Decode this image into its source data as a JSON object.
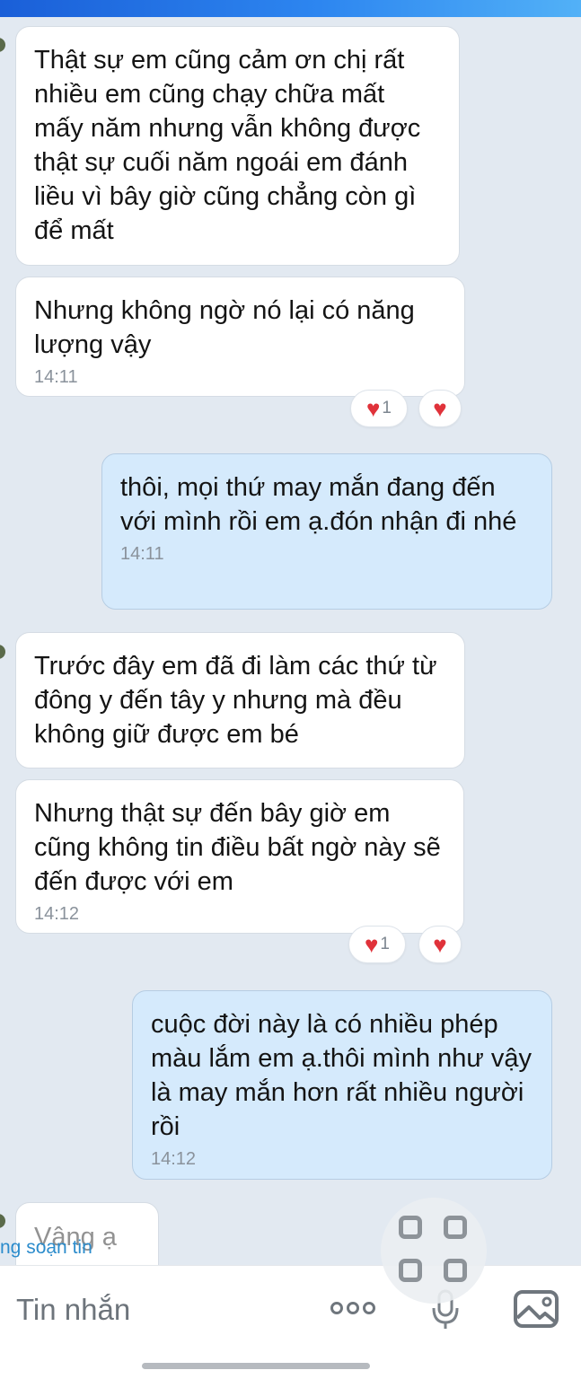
{
  "colors": {
    "background": "#e2e9f1",
    "incoming_bubble": "#ffffff",
    "outgoing_bubble": "#d5eafc",
    "heart": "#e0323a",
    "typing_text": "#2c8ccc"
  },
  "messages": [
    {
      "side": "in",
      "text": "Thật sự em cũng cảm ơn chị rất nhiều em cũng chạy chữa mất mấy năm nhưng vẫn không được thật sự cuối năm ngoái em đánh liều vì bây giờ cũng chẳng còn gì để mất",
      "time": ""
    },
    {
      "side": "in",
      "text": "Nhưng không ngờ nó lại có năng lượng vậy",
      "time": "14:11",
      "reaction_count": "1"
    },
    {
      "side": "out",
      "text": "thôi, mọi thứ may mắn đang đến với mình rồi em ạ.đón nhận đi nhé",
      "time": "14:11"
    },
    {
      "side": "in",
      "text": "Trước đây em đã đi làm các thứ từ đông y đến tây y nhưng mà đều không giữ được em bé",
      "time": ""
    },
    {
      "side": "in",
      "text": "Nhưng thật sự đến bây giờ em cũng không tin điều bất ngờ này sẽ đến được với em",
      "time": "14:12",
      "reaction_count": "1"
    },
    {
      "side": "out",
      "text": "cuộc đời này là có nhiều phép màu lắm em ạ.thôi mình như vậy là may mắn hơn rất nhiều người rồi",
      "time": "14:12"
    }
  ],
  "partial_message": "Vâng ạ",
  "typing_indicator": "ng soạn tin",
  "composer": {
    "placeholder": "Tin nhắn"
  },
  "icons": {
    "heart": "♥",
    "more": "more-dots-icon",
    "mic": "microphone-icon",
    "image": "image-icon",
    "grid": "grid-icon"
  }
}
